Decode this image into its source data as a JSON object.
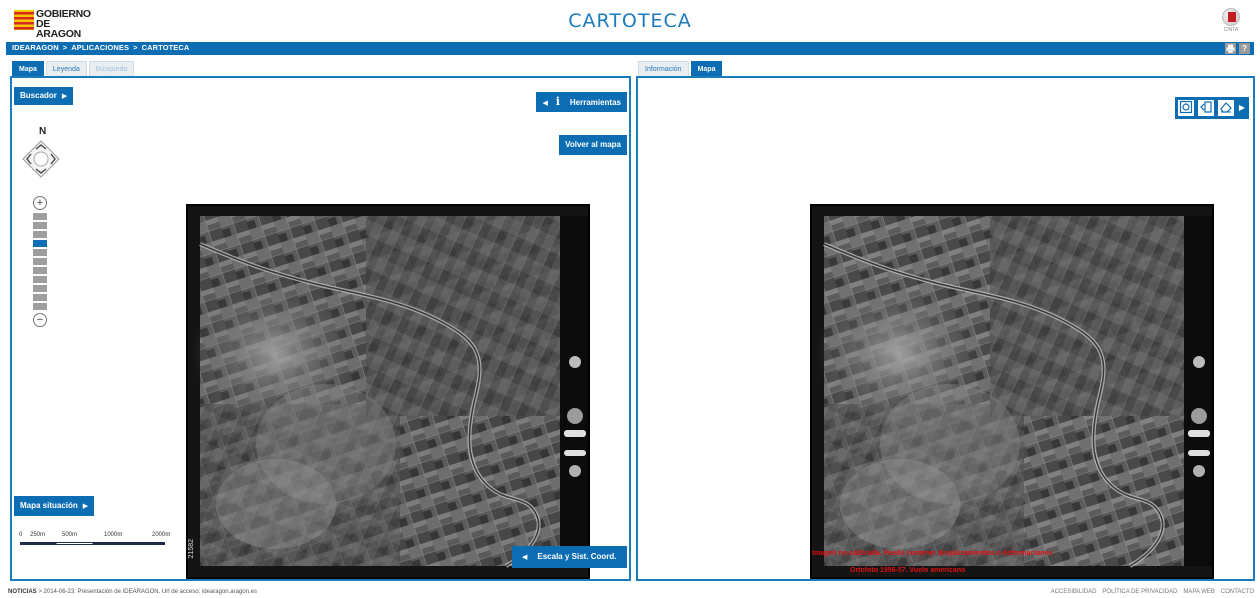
{
  "header": {
    "logo_line1": "GOBIERNO",
    "logo_line2": "DE ARAGON",
    "title": "CARTOTECA",
    "cinta_label": "CINTA"
  },
  "breadcrumb": {
    "items": [
      "IDEARAGON",
      "APLICACIONES",
      "CARTOTECA"
    ],
    "separator": ">"
  },
  "toolbar_icons": [
    "print-icon",
    "help-icon"
  ],
  "help_label": "?",
  "left_tabs": [
    {
      "label": "Mapa",
      "state": "active"
    },
    {
      "label": "Leyenda",
      "state": "inactive"
    },
    {
      "label": "Búsqueda",
      "state": "disabled"
    }
  ],
  "right_tabs": [
    {
      "label": "Información",
      "state": "inactive"
    },
    {
      "label": "Mapa",
      "state": "active"
    }
  ],
  "left_panel": {
    "buscador": "Buscador",
    "herramientas": "Herramientas",
    "volver": "Volver al mapa",
    "north": "N",
    "mapa_situacion": "Mapa situación",
    "escala": "Escala y Sist. Coord.",
    "scale_labels": [
      "0",
      "250m",
      "500m",
      "1000m",
      "2000m"
    ],
    "film_id": "21582",
    "zoom_levels": 11,
    "zoom_active": 3
  },
  "right_panel": {
    "tools": [
      "map-overview-icon",
      "measure-icon",
      "eraser-icon"
    ],
    "overlay_line1": "Imagen no calibrada. Puede contener desplazamientos o deformaciones",
    "overlay_line2": "Ortofoto 1956-57. Vuelo americano"
  },
  "footer": {
    "news_label": "NOTICIAS",
    "news_text": "2014-06-23: Presentación de IDEARAGON. Url de acceso: idearagon.aragon.es",
    "links": [
      "ACCESIBILIDAD",
      "POLÍTICA DE PRIVACIDAD",
      "MAPA WEB",
      "CONTACTO"
    ]
  },
  "colors": {
    "primary": "#0c6db3",
    "title": "#1a7bbd",
    "overlay_red": "#e01010"
  }
}
